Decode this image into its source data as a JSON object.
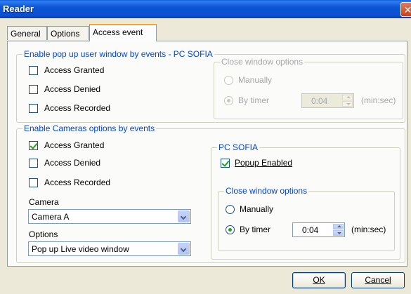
{
  "window": {
    "title": "Reader",
    "close_glyph": "✕"
  },
  "tabs": [
    {
      "label": "General",
      "active": false
    },
    {
      "label": "Options",
      "active": false
    },
    {
      "label": "Access event",
      "active": true
    }
  ],
  "popup_group": {
    "legend": "Enable pop up user window by events - PC SOFIA",
    "checkboxes": [
      {
        "label": "Access Granted",
        "checked": false
      },
      {
        "label": "Access Denied",
        "checked": false
      },
      {
        "label": "Access Recorded",
        "checked": false
      }
    ],
    "close_options": {
      "legend": "Close window options",
      "enabled": false,
      "manually_label": "Manually",
      "by_timer_label": "By timer",
      "selected": "by_timer",
      "timer_value": "0:04",
      "unit_label": "(min:sec)"
    }
  },
  "cameras_group": {
    "legend": "Enable Cameras options by events",
    "checkboxes": [
      {
        "label": "Access Granted",
        "checked": true
      },
      {
        "label": "Access Denied",
        "checked": false
      },
      {
        "label": "Access Recorded",
        "checked": false
      }
    ],
    "camera_label": "Camera",
    "camera_value": "Camera A",
    "options_label": "Options",
    "options_value": "Pop up Live video window",
    "pc_sofia": {
      "legend": "PC SOFIA",
      "popup_enabled_label": "Popup Enabled",
      "popup_enabled_checked": true,
      "close_options": {
        "legend": "Close window options",
        "manually_label": "Manually",
        "by_timer_label": "By timer",
        "selected": "by_timer",
        "timer_value": "0:04",
        "unit_label": "(min:sec)"
      }
    }
  },
  "buttons": {
    "ok_label": "OK",
    "cancel_label": "Cancel"
  },
  "colors": {
    "title_bar": "#0b4fcf",
    "legend_text": "#0046d5",
    "check_mark": "#21a121",
    "dialog_bg": "#ece9d8"
  }
}
